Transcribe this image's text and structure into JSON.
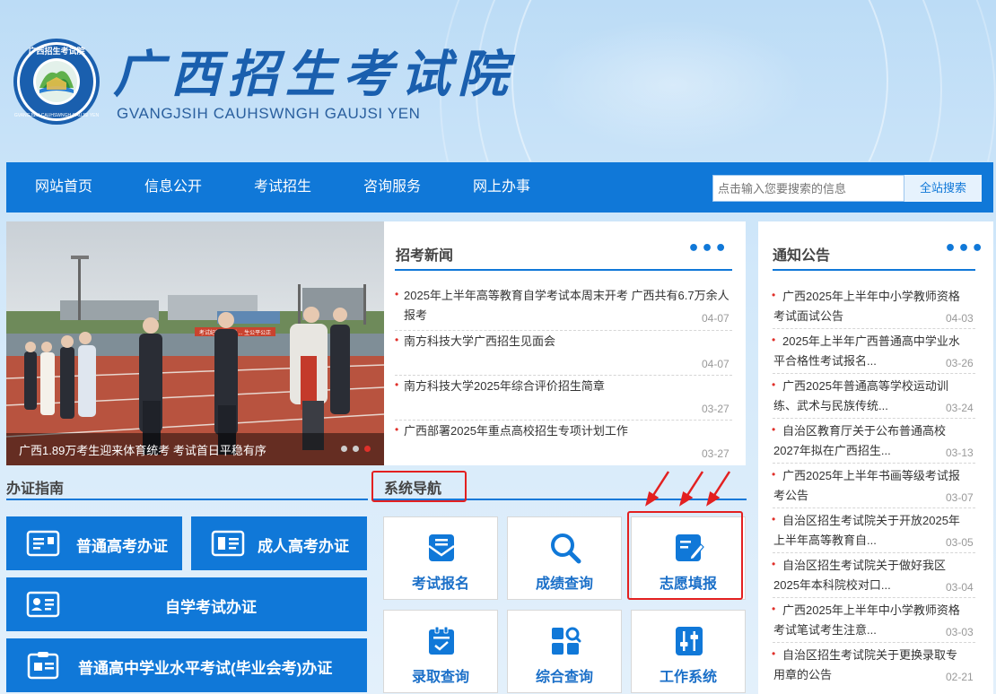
{
  "header": {
    "title": "广西招生考试院",
    "subtitle": "GVANGJSIH CAUHSWNGH GAUJSI YEN",
    "seal_text": "广西招生考试院"
  },
  "nav": {
    "items": [
      "网站首页",
      "信息公开",
      "考试招生",
      "咨询服务",
      "网上办事"
    ],
    "search_placeholder": "点击输入您要搜索的信息",
    "search_button": "全站搜索"
  },
  "carousel": {
    "caption": "广西1.89万考生迎来体育统考 考试首日平稳有序",
    "banner_text": "考试纪律和规则 ... 生公平公正",
    "active_dot": 3
  },
  "news": {
    "title": "招考新闻",
    "more": "•••",
    "items": [
      {
        "text": "2025年上半年高等教育自学考试本周末开考 广西共有6.7万余人报考",
        "date": "04-07"
      },
      {
        "text": "南方科技大学广西招生见面会",
        "date": "04-07"
      },
      {
        "text": "南方科技大学2025年综合评价招生简章",
        "date": "03-27"
      },
      {
        "text": "广西部署2025年重点高校招生专项计划工作",
        "date": "03-27"
      }
    ]
  },
  "notices": {
    "title": "通知公告",
    "more": "•••",
    "items": [
      {
        "line1": "广西2025年上半年中小学教师资格",
        "line2": "考试面试公告",
        "date": "04-03"
      },
      {
        "line1": "2025年上半年广西普通高中学业水",
        "line2": "平合格性考试报名...",
        "date": "03-26"
      },
      {
        "line1": "广西2025年普通高等学校运动训",
        "line2": "练、武术与民族传统...",
        "date": "03-24"
      },
      {
        "line1": "自治区教育厅关于公布普通高校",
        "line2": "2027年拟在广西招生...",
        "date": "03-13"
      },
      {
        "line1": "广西2025年上半年书画等级考试报",
        "line2": "考公告",
        "date": "03-07"
      },
      {
        "line1": "自治区招生考试院关于开放2025年",
        "line2": "上半年高等教育自...",
        "date": "03-05"
      },
      {
        "line1": "自治区招生考试院关于做好我区",
        "line2": "2025年本科院校对口...",
        "date": "03-04"
      },
      {
        "line1": "广西2025年上半年中小学教师资格",
        "line2": "考试笔试考生注意...",
        "date": "03-03"
      },
      {
        "line1": "自治区招生考试院关于更换录取专",
        "line2": "用章的公告",
        "date": "02-21"
      }
    ]
  },
  "guide": {
    "title": "办证指南",
    "buttons": [
      "普通高考办证",
      "成人高考办证",
      "自学考试办证",
      "普通高中学业水平考试(毕业会考)办证"
    ]
  },
  "sysnav": {
    "title": "系统导航",
    "tiles": [
      {
        "label": "考试报名",
        "icon": "mail-icon"
      },
      {
        "label": "成绩查询",
        "icon": "search-icon"
      },
      {
        "label": "志愿填报",
        "icon": "edit-icon"
      },
      {
        "label": "录取查询",
        "icon": "clipboard-check-icon"
      },
      {
        "label": "综合查询",
        "icon": "grid-search-icon"
      },
      {
        "label": "工作系统",
        "icon": "sliders-icon"
      }
    ]
  },
  "colors": {
    "primary": "#1078d8",
    "bullet": "#e0302a",
    "highlight": "#e32020"
  }
}
